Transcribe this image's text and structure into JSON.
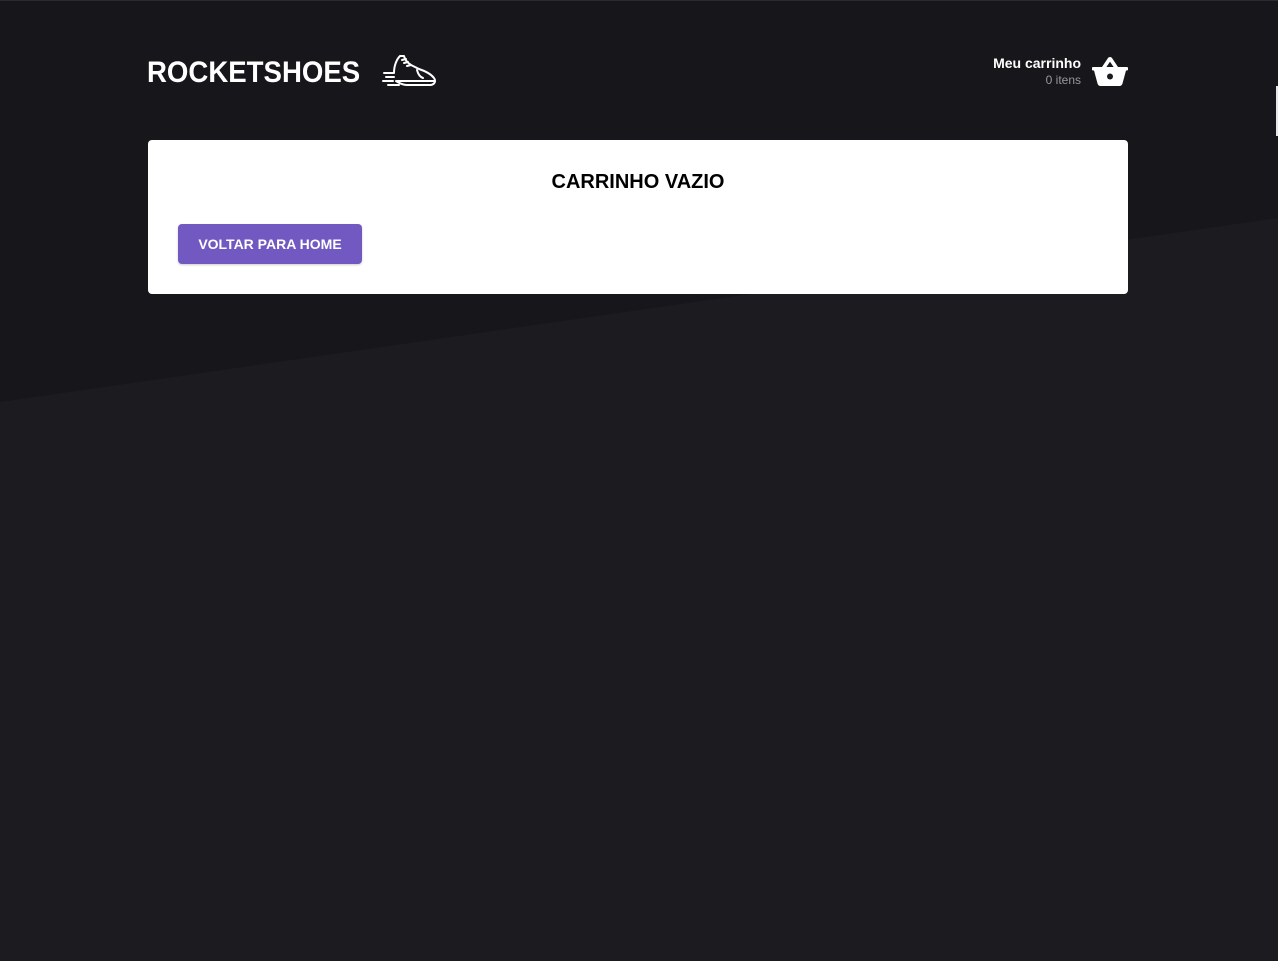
{
  "brand": {
    "name": "ROCKETSHOES",
    "logo_icon": "running-shoe-icon"
  },
  "cart_summary": {
    "title": "Meu carrinho",
    "count": "0 itens",
    "icon": "shopping-basket-icon"
  },
  "empty_cart": {
    "title": "CARRINHO VAZIO",
    "button_label": "VOLTAR PARA HOME"
  },
  "colors": {
    "background": "#191920",
    "accent": "#7159c1",
    "card": "#ffffff"
  }
}
